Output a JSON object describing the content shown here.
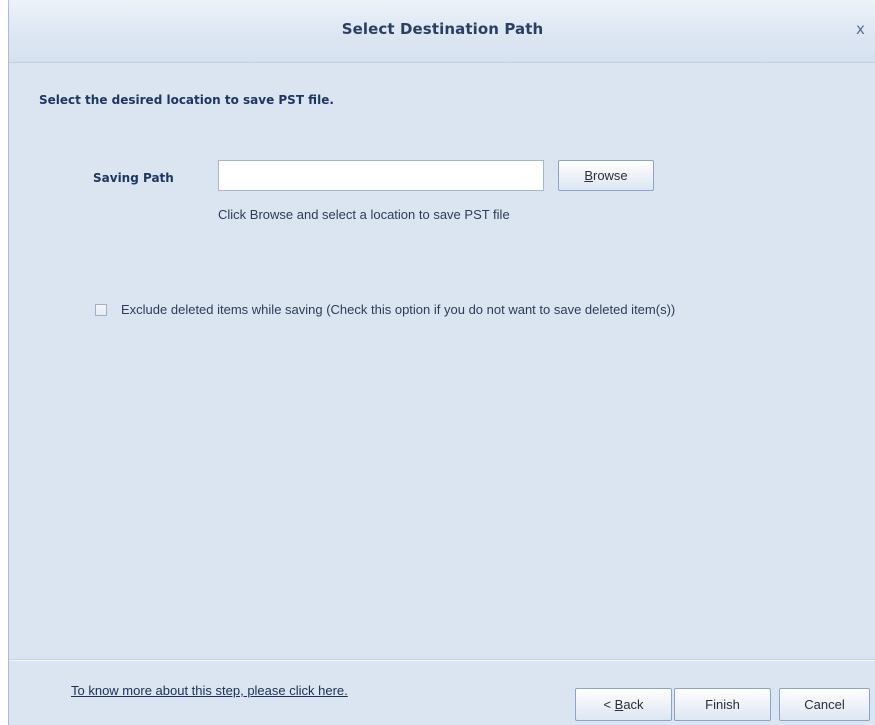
{
  "window": {
    "title": "Select Destination Path",
    "close_glyph": "x"
  },
  "content": {
    "instruction": "Select the desired location to save PST file.",
    "saving_path_label": "Saving Path",
    "saving_path_value": "",
    "saving_path_placeholder": "",
    "browse_prefix": "",
    "browse_mnemonic": "B",
    "browse_rest": "rowse",
    "hint": "Click Browse and select a location to save PST file",
    "exclude_checked": false,
    "exclude_label": "Exclude deleted items while saving  (Check this option if you do not want to save deleted item(s))"
  },
  "footer": {
    "help_link": "To know more about this step, please click here.",
    "back_prefix": "< ",
    "back_mnemonic": "B",
    "back_rest": "ack",
    "finish_label": "Finish",
    "cancel_label": "Cancel"
  },
  "colors": {
    "background": "#dbe5f1",
    "title_text": "#2a3f63",
    "label_text": "#1f3660"
  },
  "icons": {
    "close": "close-icon",
    "checkbox": "checkbox-icon"
  }
}
